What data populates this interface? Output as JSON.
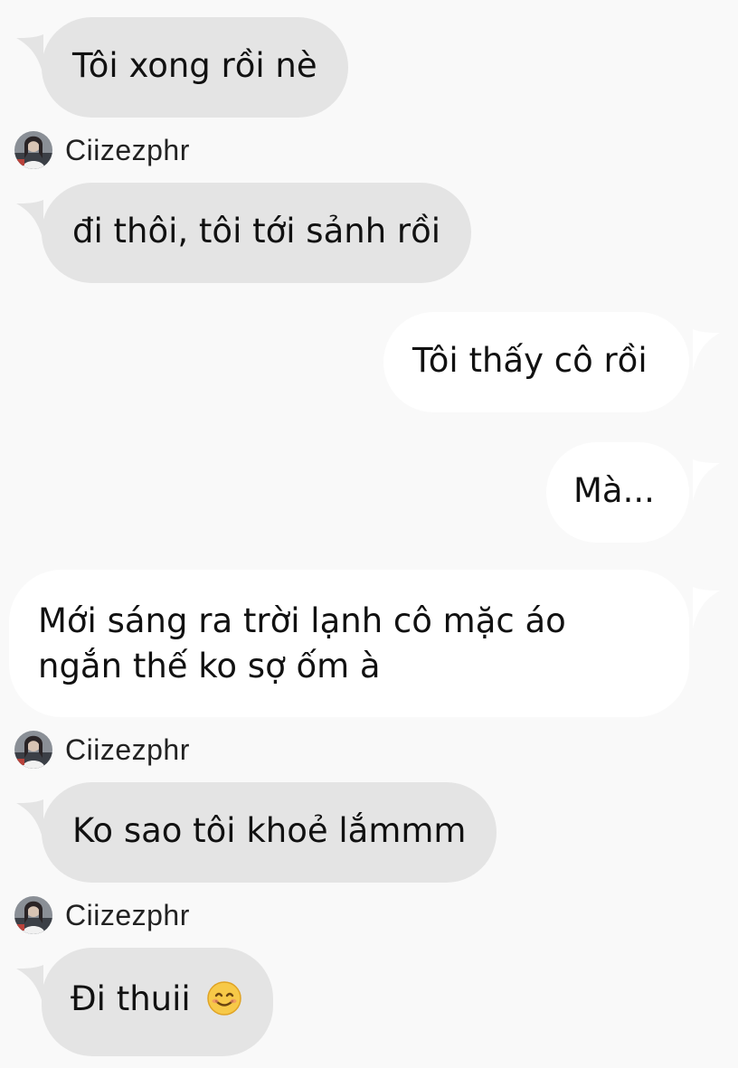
{
  "colors": {
    "background": "#f9f9f9",
    "incoming_bubble": "#e4e4e4",
    "outgoing_bubble": "#ffffff",
    "text": "#111111"
  },
  "messages": [
    {
      "direction": "incoming",
      "text": "Tôi xong rồi nè"
    },
    {
      "type": "sender",
      "name": "Ciizezphr",
      "avatar": "avatar-icon"
    },
    {
      "direction": "incoming",
      "text": "đi thôi, tôi tới sảnh rồi"
    },
    {
      "direction": "outgoing",
      "text": "Tôi thấy cô rồi"
    },
    {
      "direction": "outgoing",
      "text": "Mà..."
    },
    {
      "direction": "outgoing",
      "lines": [
        "Mới sáng ra trời lạnh cô mặc áo",
        "ngắn thế ko sợ ốm à"
      ]
    },
    {
      "type": "sender",
      "name": "Ciizezphr",
      "avatar": "avatar-icon"
    },
    {
      "direction": "incoming",
      "text": "Ko sao tôi khoẻ lắmmm"
    },
    {
      "type": "sender",
      "name": "Ciizezphr",
      "avatar": "avatar-icon"
    },
    {
      "direction": "incoming",
      "text": "Đi thuii",
      "emoji": "smiling-face-icon"
    }
  ]
}
